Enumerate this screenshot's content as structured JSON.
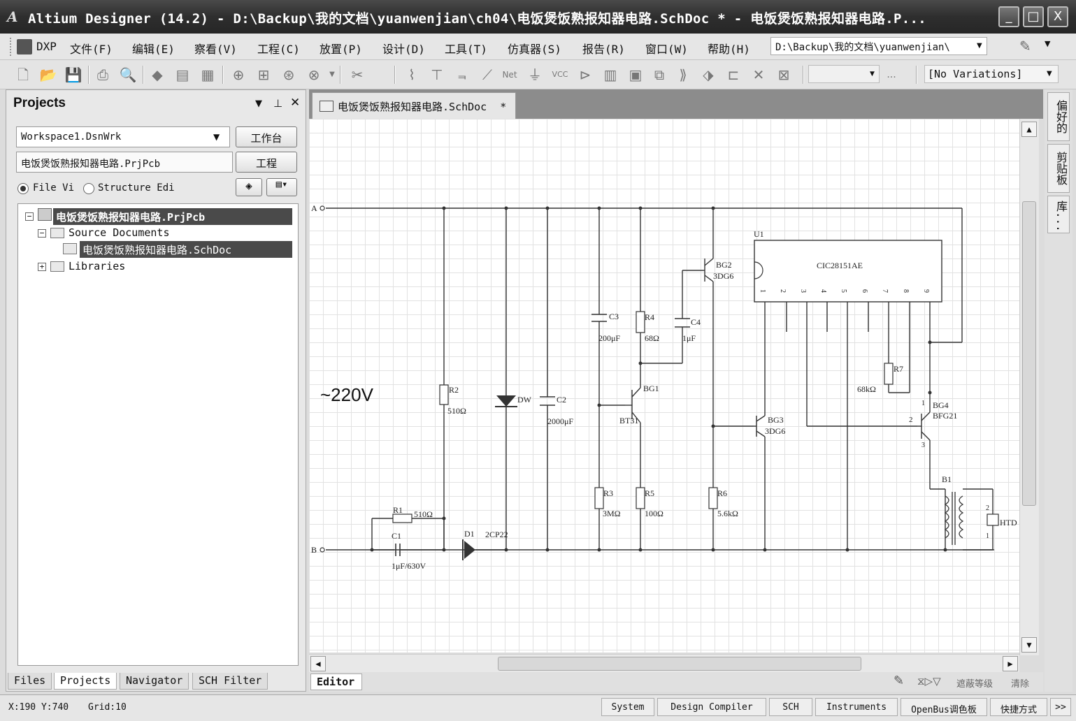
{
  "window": {
    "title": "Altium Designer (14.2) - D:\\Backup\\我的文档\\yuanwenjian\\ch04\\电饭煲饭熟报知器电路.SchDoc * - 电饭煲饭熟报知器电路.P...",
    "app_icon_text": "A",
    "minimize": "_",
    "maximize": "□",
    "close": "X"
  },
  "menu": {
    "items": [
      "DXP",
      "文件(F)",
      "编辑(E)",
      "察看(V)",
      "工程(C)",
      "放置(P)",
      "设计(D)",
      "工具(T)",
      "仿真器(S)",
      "报告(R)",
      "窗口(W)",
      "帮助(H)"
    ],
    "path_combo": "D:\\Backup\\我的文档\\yuanwenjian\\"
  },
  "toolbar": {
    "variations": "[No Variations]",
    "more": "..."
  },
  "projects_panel": {
    "title": "Projects",
    "workspace": "Workspace1.DsnWrk",
    "workspace_button": "工作台",
    "project": "电饭煲饭熟报知器电路.PrjPcb",
    "project_button": "工程",
    "radio_file_view": "File Vi",
    "radio_structure": "Structure Edi",
    "tree": {
      "project_node": "电饭煲饭熟报知器电路.PrjPcb",
      "source_documents": "Source Documents",
      "schdoc": "电饭煲饭熟报知器电路.SchDoc",
      "libraries": "Libraries"
    },
    "tabs": [
      "Files",
      "Projects",
      "Navigator",
      "SCH Filter"
    ]
  },
  "document": {
    "tab_label": "电饭煲饭熟报知器电路.SchDoc",
    "modified_marker": "*",
    "editor_tab": "Editor",
    "mask_level": "遮蔽等级",
    "clear": "清除"
  },
  "schematic": {
    "voltage_label": "~220V",
    "node_a": "A",
    "node_b": "B",
    "r1": "R1",
    "r1_val": "510Ω",
    "c1": "C1",
    "c1_val": "1μF/630V",
    "d1": "D1",
    "d1_val": "2CP22",
    "r2": "R2",
    "r2_val": "510Ω",
    "dw": "DW",
    "c2": "C2",
    "c2_val": "2000μF",
    "c3": "C3",
    "c3_val": "200μF",
    "r3": "R3",
    "r3_val": "3MΩ",
    "r4": "R4",
    "r4_val": "68Ω",
    "c4": "C4",
    "c4_val": "1μF",
    "bg1": "BG1",
    "bg1_val": "BT31",
    "r5": "R5",
    "r5_val": "100Ω",
    "bg2": "BG2",
    "bg2_val": "3DG6",
    "r6": "R6",
    "r6_val": "5.6kΩ",
    "bg3": "BG3",
    "bg3_val": "3DG6",
    "u1": "U1",
    "u1_val": "CIC28151AE",
    "u1_pins": [
      "1",
      "2",
      "3",
      "4",
      "5",
      "6",
      "7",
      "8",
      "9"
    ],
    "r7": "R7",
    "r7_val": "68kΩ",
    "bg4": "BG4",
    "bg4_val": "BFG21",
    "b1": "B1",
    "htd": "HTD",
    "pin_2": "2",
    "pin_1": "1",
    "pin_3": "3",
    "pin_4": "4"
  },
  "right_strip": {
    "tabs": [
      "偏好的",
      "剪贴板",
      "库..."
    ]
  },
  "statusbar": {
    "coords": "X:190 Y:740",
    "grid": "Grid:10",
    "buttons": [
      "System",
      "Design Compiler",
      "SCH",
      "Instruments",
      "OpenBus调色板",
      "快捷方式"
    ],
    "expand": ">>"
  },
  "colors": {
    "title_bg": "#2e2e2e",
    "selection": "#4a4a4a",
    "wire": "#333333"
  }
}
